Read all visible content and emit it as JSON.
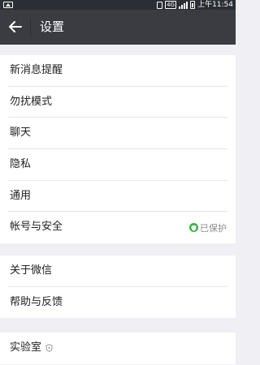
{
  "status_bar": {
    "network": "4G",
    "time": "上午11:54"
  },
  "title_bar": {
    "title": "设置"
  },
  "groups": [
    {
      "items": [
        {
          "label": "新消息提醒"
        },
        {
          "label": "勿扰模式"
        },
        {
          "label": "聊天"
        },
        {
          "label": "隐私"
        },
        {
          "label": "通用"
        },
        {
          "label": "帐号与安全",
          "status": "已保护"
        }
      ]
    },
    {
      "items": [
        {
          "label": "关于微信"
        },
        {
          "label": "帮助与反馈"
        }
      ]
    },
    {
      "items": [
        {
          "label": "实验室"
        }
      ]
    }
  ],
  "colors": {
    "status_bar": "#2b2e35",
    "title_bar": "#3a3c42",
    "background": "#efeff4",
    "protected_green": "#2eb337"
  }
}
